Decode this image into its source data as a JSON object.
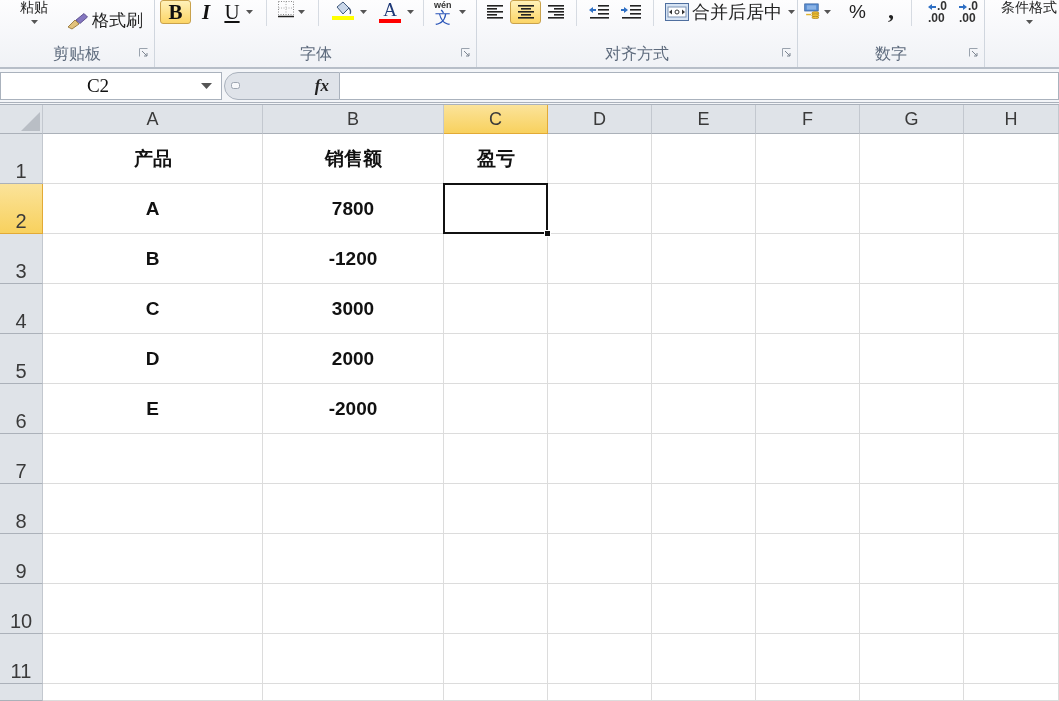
{
  "ribbon": {
    "clipboard": {
      "paste": "粘贴",
      "format_painter": "格式刷",
      "label": "剪贴板",
      "launcher": true
    },
    "font": {
      "styles": [
        {
          "kind": "bold",
          "text": "B",
          "on": true
        },
        {
          "kind": "italic",
          "text": "I",
          "on": false
        },
        {
          "kind": "underline",
          "text": "U",
          "on": false
        }
      ],
      "fill_color": {
        "color": "#ffff00"
      },
      "font_color": {
        "text": "A",
        "color": "#ff0000"
      },
      "phonetic": {
        "ruby": "wén",
        "text": "文"
      },
      "label": "字体",
      "launcher": true
    },
    "alignment": {
      "aligns": [
        {
          "kind": "left",
          "selected": false
        },
        {
          "kind": "center",
          "selected": true
        },
        {
          "kind": "right",
          "selected": false
        }
      ],
      "indents": [
        {
          "kind": "decrease"
        },
        {
          "kind": "increase"
        }
      ],
      "merge": "合并后居中",
      "label": "对齐方式",
      "launcher": true
    },
    "number": {
      "percent": "%",
      "comma": ",",
      "decimals": [
        {
          "kind": "increase",
          "top": ".0",
          "bottom": ".00"
        },
        {
          "kind": "decrease",
          "top": ".0",
          "bottom": ".00"
        }
      ],
      "label": "数字",
      "launcher": true
    },
    "styles": {
      "conditional_formatting": "条件格式"
    }
  },
  "formula_bar": {
    "name_box": "C2",
    "function_label": "fx"
  },
  "grid": {
    "columns": [
      {
        "label": "A",
        "selected": false
      },
      {
        "label": "B",
        "selected": false
      },
      {
        "label": "C",
        "selected": true
      },
      {
        "label": "D",
        "selected": false
      },
      {
        "label": "E",
        "selected": false
      },
      {
        "label": "F",
        "selected": false
      },
      {
        "label": "G",
        "selected": false
      },
      {
        "label": "H",
        "selected": false
      }
    ],
    "rows": [
      {
        "header": "1",
        "selected": false,
        "cells": [
          "产品",
          "销售额",
          "盈亏"
        ]
      },
      {
        "header": "2",
        "selected": true,
        "cells": [
          "A",
          "7800"
        ]
      },
      {
        "header": "3",
        "selected": false,
        "cells": [
          "B",
          "-1200"
        ]
      },
      {
        "header": "4",
        "selected": false,
        "cells": [
          "C",
          "3000"
        ]
      },
      {
        "header": "5",
        "selected": false,
        "cells": [
          "D",
          "2000"
        ]
      },
      {
        "header": "6",
        "selected": false,
        "cells": [
          "E",
          "-2000"
        ]
      },
      {
        "header": "7",
        "selected": false
      },
      {
        "header": "8",
        "selected": false
      },
      {
        "header": "9",
        "selected": false
      },
      {
        "header": "10",
        "selected": false
      },
      {
        "header": "11",
        "selected": false
      }
    ]
  }
}
